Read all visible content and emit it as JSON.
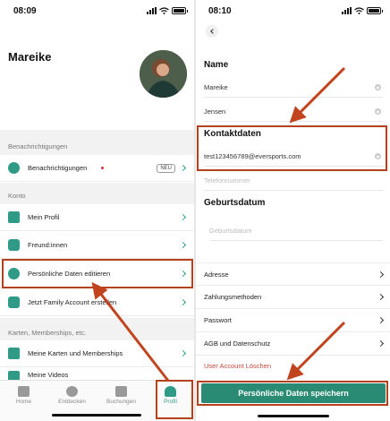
{
  "left": {
    "status_time": "08:09",
    "profile_name": "Mareike",
    "sections": {
      "notifications": "Benachrichtigungen",
      "account": "Konto",
      "cards": "Karten, Memberships, etc."
    },
    "rows": {
      "notifications": "Benachrichtigungen",
      "notifications_badge": "NEU",
      "profile": "Mein Profil",
      "friends": "Freund:innen",
      "edit_personal": "Persönliche Daten editieren",
      "family": "Jetzt Family Account erstellen",
      "cards": "Meine Karten und Memberships",
      "videos": "Meine Videos"
    },
    "tabs": {
      "home": "Home",
      "discover": "Entdecken",
      "bookings": "Buchungen",
      "profile": "Profil"
    }
  },
  "right": {
    "status_time": "08:10",
    "name_heading": "Name",
    "first_name": "Mareike",
    "last_name": "Jensen",
    "contact_heading": "Kontaktdaten",
    "email": "test123456789@eversports.com",
    "phone_placeholder": "Telefonnummer",
    "birth_heading": "Geburtsdatum",
    "birth_placeholder": "Geburtsdatum",
    "rows": {
      "address": "Adresse",
      "payment": "Zahlungsmethoden",
      "password": "Passwort",
      "terms": "AGB und Datenschutz"
    },
    "delete_account": "User Account Löschen",
    "save_button": "Persönliche Daten speichern"
  },
  "colors": {
    "accent": "#2f9b86",
    "highlight": "#b5401c",
    "save_button": "#2a8b75"
  }
}
